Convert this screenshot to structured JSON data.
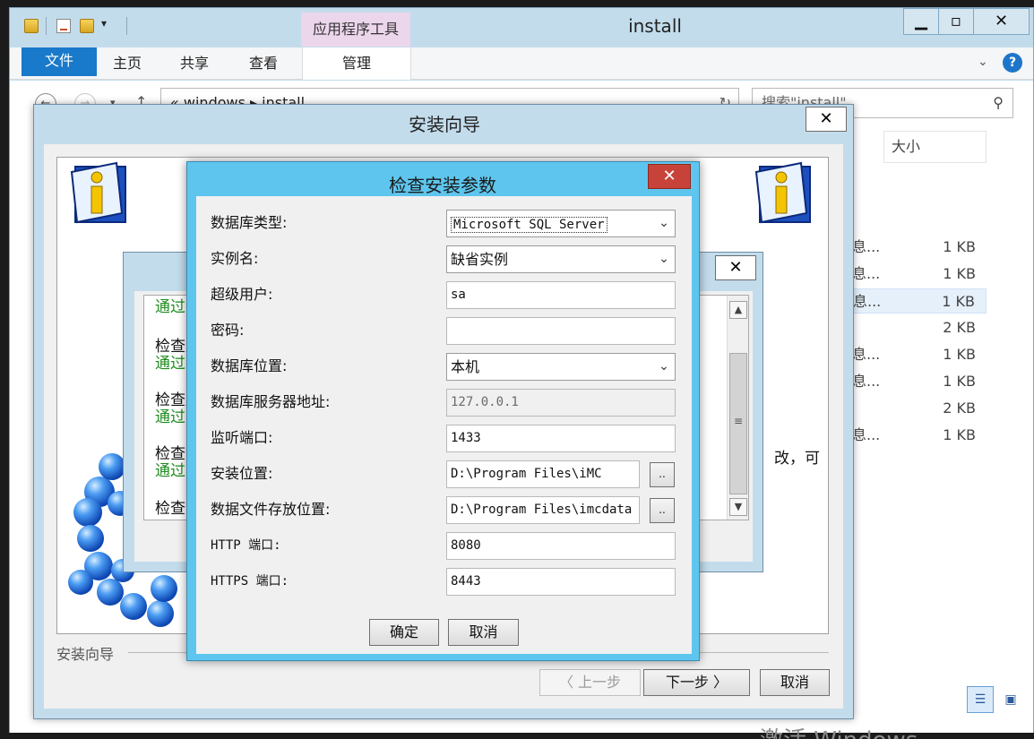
{
  "explorer": {
    "title": "install",
    "context_tab_group": "应用程序工具",
    "ribbon_tabs": [
      "文件",
      "主页",
      "共享",
      "查看",
      "管理"
    ],
    "address": {
      "prefix": "«",
      "crumbs": [
        "windows",
        "install"
      ]
    },
    "search_placeholder": "搜索\"install\"",
    "column_size": "大小",
    "files": [
      {
        "name": "息...",
        "size": "1 KB"
      },
      {
        "name": "息...",
        "size": "1 KB"
      },
      {
        "name": "息...",
        "size": "1 KB",
        "selected": true
      },
      {
        "name": "",
        "size": "2 KB"
      },
      {
        "name": "息...",
        "size": "1 KB"
      },
      {
        "name": "息...",
        "size": "1 KB"
      },
      {
        "name": "",
        "size": "2 KB"
      },
      {
        "name": "息...",
        "size": "1 KB"
      }
    ],
    "caption_buttons": {
      "minimize": "▁",
      "maximize": "▫",
      "close": "✕"
    },
    "help_icon": "?"
  },
  "wizard": {
    "title": "安装向导",
    "group_label": "安装向导",
    "side_text": "改，可",
    "buttons": {
      "prev": "〈 上一步",
      "next": "下一步 〉",
      "cancel": "取消"
    }
  },
  "check_window": {
    "items": [
      {
        "title": "检查服",
        "status": "通过"
      },
      {
        "title": "检查服",
        "status": "通过"
      },
      {
        "title": "检查服",
        "status": "通过"
      },
      {
        "title": "检查数",
        "status": "通过"
      },
      {
        "title": "检查数",
        "status": ""
      }
    ],
    "top_status": "通过"
  },
  "dialog": {
    "title": "检查安装参数",
    "close": "✕",
    "fields": {
      "db_type_label": "数据库类型:",
      "db_type_value": "Microsoft SQL Server",
      "instance_label": "实例名:",
      "instance_value": "缺省实例",
      "superuser_label": "超级用户:",
      "superuser_value": "sa",
      "password_label": "密码:",
      "password_value": "",
      "db_location_label": "数据库位置:",
      "db_location_value": "本机",
      "db_server_label": "数据库服务器地址:",
      "db_server_value": "127.0.0.1",
      "port_label": "监听端口:",
      "port_value": "1433",
      "install_path_label": "安装位置:",
      "install_path_value": "D:\\Program Files\\iMC",
      "data_path_label": "数据文件存放位置:",
      "data_path_value": "D:\\Program Files\\imcdata",
      "http_label": "HTTP 端口:",
      "http_value": "8080",
      "https_label": "HTTPS 端口:",
      "https_value": "8443"
    },
    "browse_label": "..",
    "ok": "确定",
    "cancel": "取消"
  },
  "watermark": "激活 Windows",
  "colors": {
    "title_bar": "#c3dcec",
    "dialog_frame": "#5ec6ee",
    "close_red": "#c7433a",
    "ribbon_file": "#1979ca",
    "pass_green": "#1d8d1d"
  }
}
